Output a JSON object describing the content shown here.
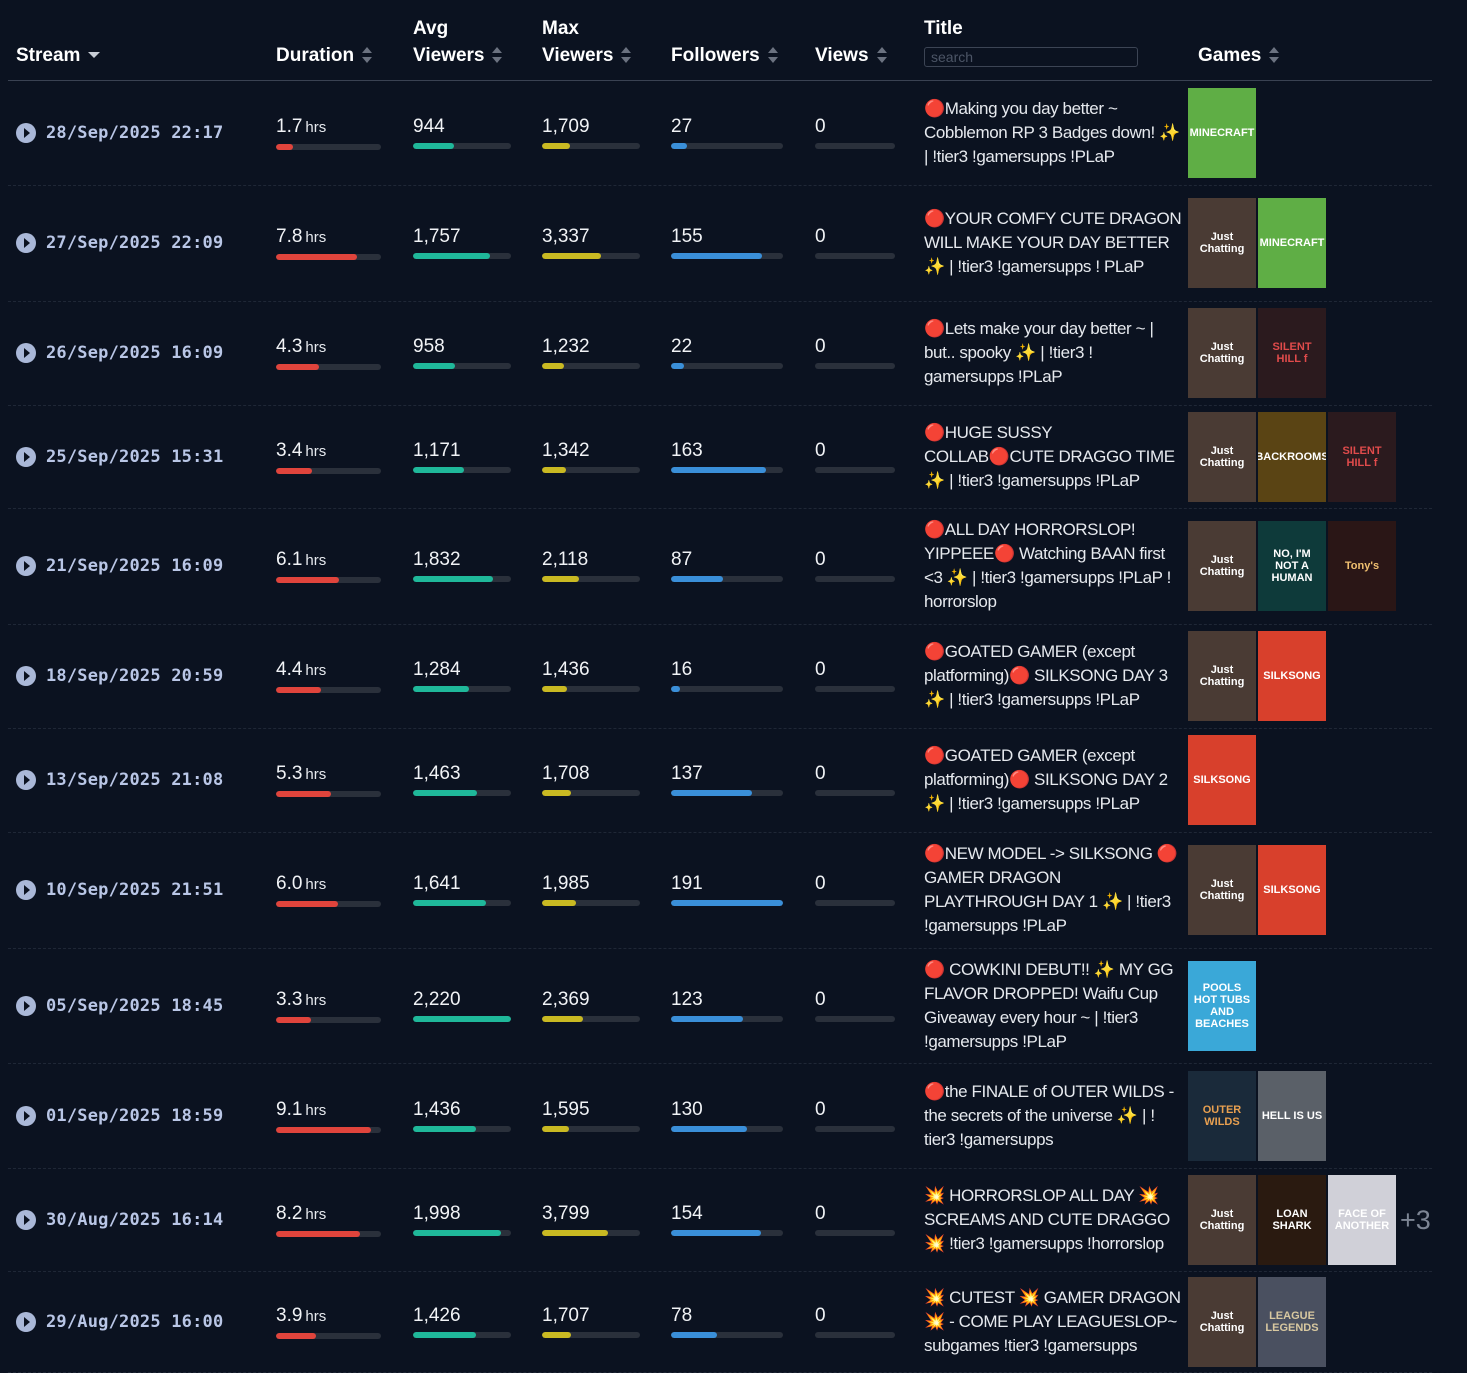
{
  "header": {
    "stream": "Stream",
    "duration": "Duration",
    "avg_line1": "Avg",
    "avg_line2": "Viewers",
    "max_line1": "Max",
    "max_line2": "Viewers",
    "followers": "Followers",
    "views": "Views",
    "title": "Title",
    "search_placeholder": "search",
    "games": "Games"
  },
  "colors": {
    "duration": "#e0443c",
    "avg": "#1fb89a",
    "max": "#c9b922",
    "followers": "#3a8fd9",
    "views": "#2a303b"
  },
  "games_catalog": {
    "minecraft": {
      "label": "MINECRAFT",
      "bg": "#5fae45",
      "fg": "#ffffff"
    },
    "just_chatting": {
      "label": "Just Chatting",
      "bg": "#4a3b34",
      "fg": "#ffffff"
    },
    "silent_hill": {
      "label": "SILENT HILL f",
      "bg": "#2b1a1e",
      "fg": "#e04b4b"
    },
    "backrooms": {
      "label": "BACKROOMS",
      "bg": "#5a4414",
      "fg": "#ffffff"
    },
    "no_im_not_human": {
      "label": "NO, I'M NOT A HUMAN",
      "bg": "#0e3a3a",
      "fg": "#ffffff"
    },
    "tonys": {
      "label": "Tony's",
      "bg": "#2a1616",
      "fg": "#f0c070"
    },
    "silksong": {
      "label": "SILKSONG",
      "bg": "#d8402c",
      "fg": "#ffffff"
    },
    "pools": {
      "label": "POOLS HOT TUBS AND BEACHES",
      "bg": "#3aa8d8",
      "fg": "#ffffff"
    },
    "outer_wilds": {
      "label": "OUTER WILDS",
      "bg": "#1a2a3a",
      "fg": "#e8a050"
    },
    "hell_is_us": {
      "label": "HELL IS US",
      "bg": "#5a6068",
      "fg": "#ffffff"
    },
    "loan_shark": {
      "label": "LOAN SHARK",
      "bg": "#2a1a10",
      "fg": "#ffffff"
    },
    "face_of_another": {
      "label": "FACE OF ANOTHER",
      "bg": "#d0d0d8",
      "fg": "#ffffff"
    },
    "league": {
      "label": "LEAGUE LEGENDS",
      "bg": "#4a5060",
      "fg": "#d8c8a0"
    }
  },
  "rows": [
    {
      "date": "28/Sep/2025 22:17",
      "duration": "1.7",
      "avg": "944",
      "max": "1,709",
      "followers": "27",
      "views": "0",
      "title": "🔴Making you day better ~ Cobblemon RP 3 Badges down! ✨ | !tier3 !gamersupps !PLaP",
      "games": [
        "minecraft"
      ],
      "more": "",
      "dur_pct": 0.16,
      "avg_pct": 0.42,
      "max_pct": 0.29,
      "fol_pct": 0.14
    },
    {
      "date": "27/Sep/2025 22:09",
      "duration": "7.8",
      "avg": "1,757",
      "max": "3,337",
      "followers": "155",
      "views": "0",
      "title": "🔴YOUR COMFY CUTE DRAGON WILL MAKE YOUR DAY BETTER ✨ | !tier3 !gamersupps ! PLaP",
      "games": [
        "just_chatting",
        "minecraft"
      ],
      "more": "",
      "dur_pct": 0.77,
      "avg_pct": 0.79,
      "max_pct": 0.6,
      "fol_pct": 0.81
    },
    {
      "date": "26/Sep/2025 16:09",
      "duration": "4.3",
      "avg": "958",
      "max": "1,232",
      "followers": "22",
      "views": "0",
      "title": "🔴Lets make your day better ~ | but.. spooky ✨ | !tier3 ! gamersupps !PLaP",
      "games": [
        "just_chatting",
        "silent_hill"
      ],
      "more": "",
      "dur_pct": 0.41,
      "avg_pct": 0.43,
      "max_pct": 0.22,
      "fol_pct": 0.12
    },
    {
      "date": "25/Sep/2025 15:31",
      "duration": "3.4",
      "avg": "1,171",
      "max": "1,342",
      "followers": "163",
      "views": "0",
      "title": "🔴HUGE SUSSY COLLAB🔴CUTE DRAGGO TIME ✨ | !tier3 !gamersupps !PLaP",
      "games": [
        "just_chatting",
        "backrooms",
        "silent_hill"
      ],
      "more": "",
      "dur_pct": 0.34,
      "avg_pct": 0.52,
      "max_pct": 0.24,
      "fol_pct": 0.85
    },
    {
      "date": "21/Sep/2025 16:09",
      "duration": "6.1",
      "avg": "1,832",
      "max": "2,118",
      "followers": "87",
      "views": "0",
      "title": "🔴ALL DAY HORRORSLOP! YIPPEEE🔴 Watching BAAN first <3 ✨ | !tier3 !gamersupps !PLaP ! horrorslop",
      "games": [
        "just_chatting",
        "no_im_not_human",
        "tonys"
      ],
      "more": "",
      "dur_pct": 0.6,
      "avg_pct": 0.82,
      "max_pct": 0.38,
      "fol_pct": 0.46
    },
    {
      "date": "18/Sep/2025 20:59",
      "duration": "4.4",
      "avg": "1,284",
      "max": "1,436",
      "followers": "16",
      "views": "0",
      "title": "🔴GOATED GAMER (except platforming)🔴 SILKSONG DAY 3 ✨ | !tier3 !gamersupps !PLaP",
      "games": [
        "just_chatting",
        "silksong"
      ],
      "more": "",
      "dur_pct": 0.43,
      "avg_pct": 0.57,
      "max_pct": 0.26,
      "fol_pct": 0.08
    },
    {
      "date": "13/Sep/2025 21:08",
      "duration": "5.3",
      "avg": "1,463",
      "max": "1,708",
      "followers": "137",
      "views": "0",
      "title": "🔴GOATED GAMER (except platforming)🔴 SILKSONG DAY 2 ✨ | !tier3 !gamersupps !PLaP",
      "games": [
        "silksong"
      ],
      "more": "",
      "dur_pct": 0.52,
      "avg_pct": 0.65,
      "max_pct": 0.3,
      "fol_pct": 0.72
    },
    {
      "date": "10/Sep/2025 21:51",
      "duration": "6.0",
      "avg": "1,641",
      "max": "1,985",
      "followers": "191",
      "views": "0",
      "title": "🔴NEW MODEL -> SILKSONG 🔴 GAMER DRAGON PLAYTHROUGH DAY 1 ✨ | !tier3 !gamersupps !PLaP",
      "games": [
        "just_chatting",
        "silksong"
      ],
      "more": "",
      "dur_pct": 0.59,
      "avg_pct": 0.74,
      "max_pct": 0.35,
      "fol_pct": 1.0
    },
    {
      "date": "05/Sep/2025 18:45",
      "duration": "3.3",
      "avg": "2,220",
      "max": "2,369",
      "followers": "123",
      "views": "0",
      "title": "🔴 COWKINI DEBUT!! ✨ MY GG FLAVOR DROPPED! Waifu Cup Giveaway every hour ~ | !tier3 !gamersupps !PLaP",
      "games": [
        "pools"
      ],
      "more": "",
      "dur_pct": 0.33,
      "avg_pct": 1.0,
      "max_pct": 0.42,
      "fol_pct": 0.64
    },
    {
      "date": "01/Sep/2025 18:59",
      "duration": "9.1",
      "avg": "1,436",
      "max": "1,595",
      "followers": "130",
      "views": "0",
      "title": "🔴the FINALE of OUTER WILDS - the secrets of the universe ✨ | ! tier3 !gamersupps",
      "games": [
        "outer_wilds",
        "hell_is_us"
      ],
      "more": "",
      "dur_pct": 0.9,
      "avg_pct": 0.64,
      "max_pct": 0.28,
      "fol_pct": 0.68
    },
    {
      "date": "30/Aug/2025 16:14",
      "duration": "8.2",
      "avg": "1,998",
      "max": "3,799",
      "followers": "154",
      "views": "0",
      "title": "💥 HORRORSLOP ALL DAY 💥 SCREAMS AND CUTE DRAGGO 💥 !tier3 !gamersupps !horrorslop",
      "games": [
        "just_chatting",
        "loan_shark",
        "face_of_another"
      ],
      "more": "+3",
      "dur_pct": 0.8,
      "avg_pct": 0.9,
      "max_pct": 0.67,
      "fol_pct": 0.8
    },
    {
      "date": "29/Aug/2025 16:00",
      "duration": "3.9",
      "avg": "1,426",
      "max": "1,707",
      "followers": "78",
      "views": "0",
      "title": "💥 CUTEST 💥 GAMER DRAGON 💥 - COME PLAY LEAGUESLOP~ subgames !tier3 !gamersupps",
      "games": [
        "just_chatting",
        "league"
      ],
      "more": "",
      "dur_pct": 0.38,
      "avg_pct": 0.64,
      "max_pct": 0.3,
      "fol_pct": 0.41
    }
  ],
  "unit": "hrs"
}
